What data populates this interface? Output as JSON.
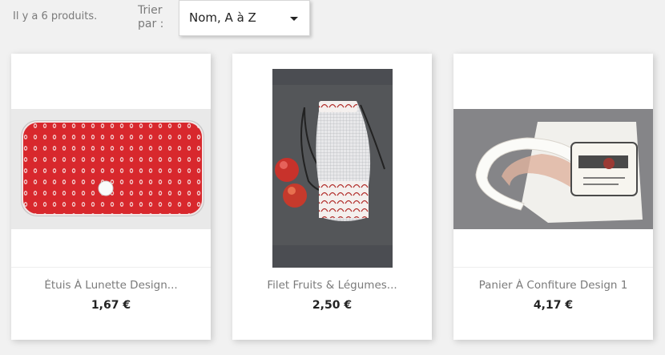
{
  "header": {
    "product_count": "Il y a 6 produits.",
    "sort_label": "Trier par :",
    "sort_value": "Nom, A à Z"
  },
  "products": [
    {
      "name": "Étuis À Lunette Design...",
      "price": "1,67 €",
      "image": "red-glasses-case-photo"
    },
    {
      "name": "Filet Fruits & Légumes...",
      "price": "2,50 €",
      "image": "drawstring-produce-bag-photo"
    },
    {
      "name": "Panier À Confiture Design 1",
      "price": "4,17 €",
      "image": "jam-basket-photo"
    }
  ]
}
